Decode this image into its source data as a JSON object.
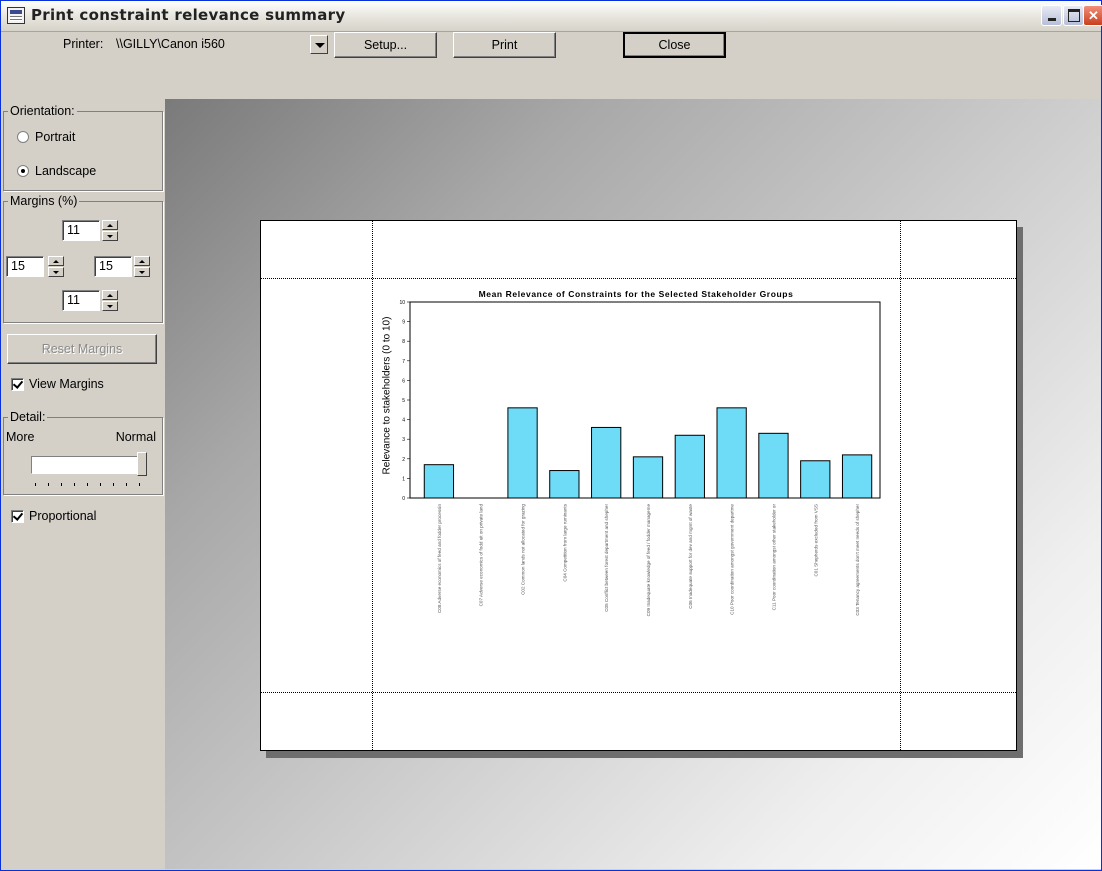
{
  "window": {
    "title": "Print constraint relevance summary",
    "controls": {
      "minimize": "minimize",
      "maximize": "maximize",
      "close": "close"
    }
  },
  "toolbar": {
    "printer_label": "Printer:",
    "printer_value": "\\\\GILLY\\Canon i560",
    "setup_label": "Setup...",
    "print_label": "Print",
    "close_label": "Close"
  },
  "orientation": {
    "title": "Orientation:",
    "options": [
      {
        "label": "Portrait",
        "selected": false
      },
      {
        "label": "Landscape",
        "selected": true
      }
    ]
  },
  "margins": {
    "title": "Margins (%)",
    "top": "11",
    "left": "15",
    "right": "15",
    "bottom": "11",
    "reset_label": "Reset Margins",
    "view_margins_label": "View Margins",
    "view_margins_checked": true
  },
  "detail": {
    "title": "Detail:",
    "left_label": "More",
    "right_label": "Normal",
    "slider_level": 1.0
  },
  "proportional": {
    "label": "Proportional",
    "checked": true
  },
  "chart_data": {
    "type": "bar",
    "title": "Mean Relevance of Constraints for the Selected Stakeholder Groups",
    "xlabel": "",
    "ylabel": "Relevance to stakeholders (0 to 10)",
    "ylim": [
      0,
      10
    ],
    "yticks": [
      "0",
      "1",
      "2",
      "3",
      "4",
      "5",
      "6",
      "7",
      "8",
      "9",
      "10"
    ],
    "categories": [
      "C08 Adverse economics of feed and fodder processin",
      "C07 Adverse economics of fodd uit on private land",
      "C02 Common lands not allocated for grazing",
      "C04 Competition from large ruminants",
      "C05 Conflict between forest department and shepher",
      "C09 Inadequate knowledge of feed / fodder manageme",
      "C06 Inadequate support for dev and mgmt of waste",
      "C10 Poor coordination amongst government departme",
      "C11 Poor coordination amongst other stakeholder or",
      "C01 Shepherds excluded from VSS",
      "C03 Tenancy agreements don't meet needs of shepher"
    ],
    "values": [
      1.7,
      0,
      4.6,
      1.4,
      3.6,
      2.1,
      3.2,
      4.6,
      3.3,
      1.9,
      2.2
    ],
    "bar_color": "#6fdcf7",
    "grid": false
  }
}
